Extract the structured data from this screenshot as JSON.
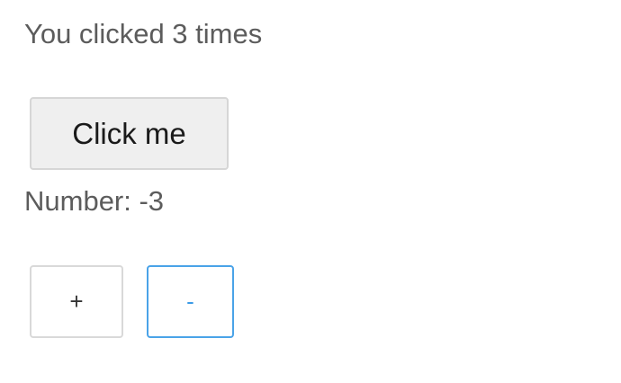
{
  "counter": {
    "click_text": "You clicked 3 times",
    "button_label": "Click me"
  },
  "number": {
    "label_text": "Number: -3",
    "increment_label": "+",
    "decrement_label": "-"
  },
  "colors": {
    "text": "#5c5c5c",
    "button_background": "#efefef",
    "focused_border": "#4aa3e8"
  }
}
